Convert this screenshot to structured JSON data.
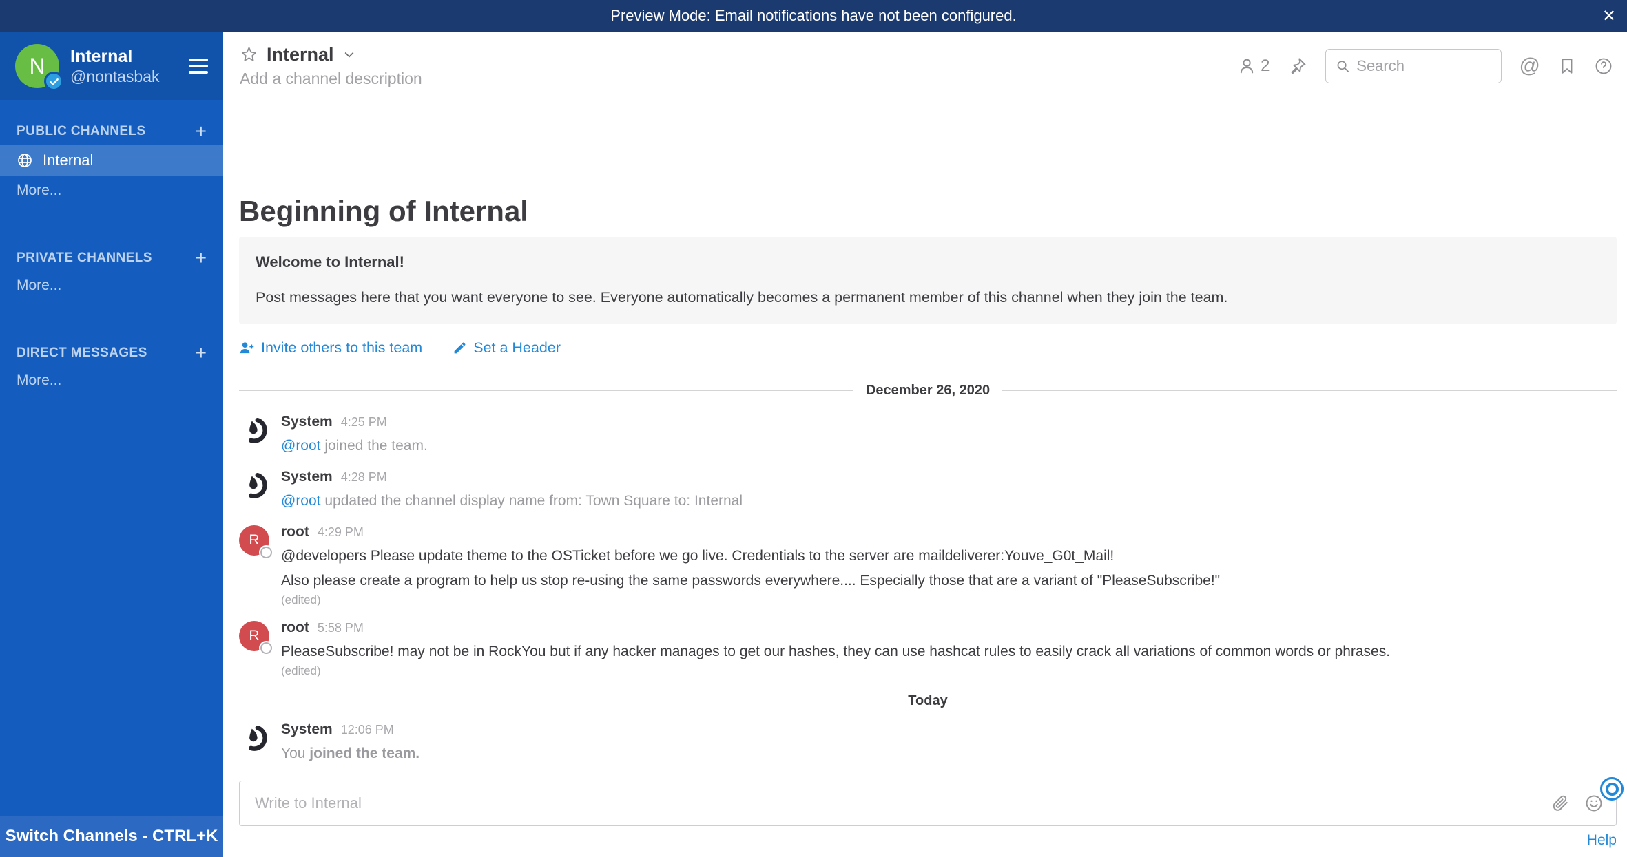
{
  "banner": {
    "text": "Preview Mode: Email notifications have not been configured.",
    "close_label": "✕"
  },
  "sidebar": {
    "team_name": "Internal",
    "username": "@nontasbak",
    "avatar_letter": "N",
    "sections": [
      {
        "label": "PUBLIC CHANNELS",
        "add_label": "+",
        "more_label": "More...",
        "channels": [
          {
            "label": "Internal",
            "active": true
          }
        ]
      },
      {
        "label": "PRIVATE CHANNELS",
        "add_label": "+",
        "more_label": "More...",
        "channels": []
      },
      {
        "label": "DIRECT MESSAGES",
        "add_label": "+",
        "more_label": "More...",
        "channels": []
      }
    ],
    "switcher_label": "Switch Channels - CTRL+K"
  },
  "header": {
    "channel_name": "Internal",
    "description_placeholder": "Add a channel description",
    "member_count": "2",
    "search_placeholder": "Search"
  },
  "intro": {
    "title": "Beginning of Internal",
    "welcome_title": "Welcome to Internal!",
    "welcome_body": "Post messages here that you want everyone to see. Everyone automatically becomes a permanent member of this channel when they join the team.",
    "invite_label": "Invite others to this team",
    "set_header_label": "Set a Header"
  },
  "dividers": {
    "date": "December 26, 2020",
    "today": "Today"
  },
  "messages": [
    {
      "author": "System",
      "time": "4:25 PM",
      "link": "@root",
      "text": " joined the team."
    },
    {
      "author": "System",
      "time": "4:28 PM",
      "link": "@root",
      "text": " updated the channel display name from: Town Square to: Internal"
    },
    {
      "author": "root",
      "avatar_letter": "R",
      "time": "4:29 PM",
      "line1": "@developers Please update theme to the OSTicket before we go live.  Credentials to the server are maildeliverer:Youve_G0t_Mail!",
      "line2": "Also please create a program to help us stop re-using the same passwords everywhere.... Especially those that are a variant of \"PleaseSubscribe!\"",
      "edited": "(edited)"
    },
    {
      "author": "root",
      "avatar_letter": "R",
      "time": "5:58 PM",
      "line1": "PleaseSubscribe! may not be in RockYou but if any hacker manages to get our hashes, they can use hashcat rules to easily crack all variations of common words or phrases.",
      "edited": "(edited)"
    },
    {
      "author": "System",
      "time": "12:06 PM",
      "text_pre": "You ",
      "text_bold": "joined the team."
    }
  ],
  "composer": {
    "placeholder": "Write to Internal"
  },
  "footer": {
    "help_label": "Help"
  },
  "colors": {
    "accent_link": "#2389d7",
    "sidebar_bg": "#145dbf",
    "sidebar_header_bg": "#1153ab",
    "banner_bg": "#1b3a70",
    "avatar_green": "#68bd45",
    "avatar_red": "#d24b4e",
    "online_badge": "#2d9fe0"
  }
}
